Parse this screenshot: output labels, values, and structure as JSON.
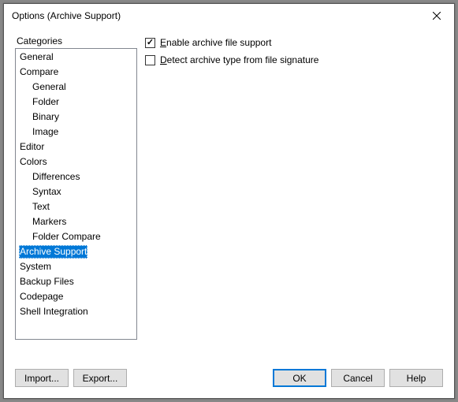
{
  "window": {
    "title": "Options (Archive Support)"
  },
  "categories": {
    "label": "Categories",
    "items": [
      {
        "label": "General",
        "level": 0,
        "selected": false
      },
      {
        "label": "Compare",
        "level": 0,
        "selected": false
      },
      {
        "label": "General",
        "level": 1,
        "selected": false
      },
      {
        "label": "Folder",
        "level": 1,
        "selected": false
      },
      {
        "label": "Binary",
        "level": 1,
        "selected": false
      },
      {
        "label": "Image",
        "level": 1,
        "selected": false
      },
      {
        "label": "Editor",
        "level": 0,
        "selected": false
      },
      {
        "label": "Colors",
        "level": 0,
        "selected": false
      },
      {
        "label": "Differences",
        "level": 1,
        "selected": false
      },
      {
        "label": "Syntax",
        "level": 1,
        "selected": false
      },
      {
        "label": "Text",
        "level": 1,
        "selected": false
      },
      {
        "label": "Markers",
        "level": 1,
        "selected": false
      },
      {
        "label": "Folder Compare",
        "level": 1,
        "selected": false
      },
      {
        "label": "Archive Support",
        "level": 0,
        "selected": true
      },
      {
        "label": "System",
        "level": 0,
        "selected": false
      },
      {
        "label": "Backup Files",
        "level": 0,
        "selected": false
      },
      {
        "label": "Codepage",
        "level": 0,
        "selected": false
      },
      {
        "label": "Shell Integration",
        "level": 0,
        "selected": false
      }
    ]
  },
  "options": {
    "enable_archive": {
      "checked": true,
      "prefix": "",
      "accel": "E",
      "suffix": "nable archive file support"
    },
    "detect_signature": {
      "checked": false,
      "prefix": "",
      "accel": "D",
      "suffix": "etect archive type from file signature"
    }
  },
  "buttons": {
    "import": "Import...",
    "export": "Export...",
    "ok": "OK",
    "cancel": "Cancel",
    "help": "Help"
  }
}
